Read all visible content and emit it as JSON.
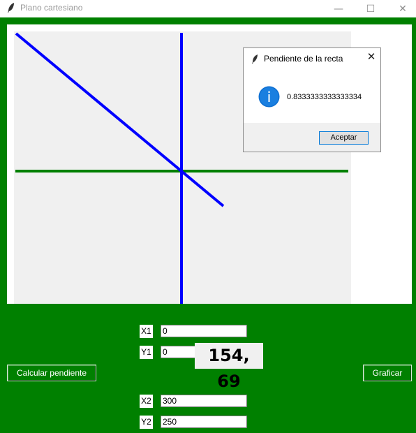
{
  "window": {
    "title": "Plano cartesiano",
    "controls": {
      "minimize": "—",
      "maximize": "☐",
      "close": "✕"
    }
  },
  "colors": {
    "frame": "#008000",
    "plot_background": "#f0f0f0",
    "axis_x": "#008000",
    "axis_y": "#0000ff",
    "line": "#0000ff"
  },
  "dialog": {
    "title": "Pendiente de la recta",
    "message": "0.8333333333333334",
    "ok_label": "Aceptar",
    "icon": "info-icon"
  },
  "form": {
    "x1": {
      "label": "X1",
      "value": "0"
    },
    "y1": {
      "label": "Y1",
      "value": "0"
    },
    "x2": {
      "label": "X2",
      "value": "300"
    },
    "y2": {
      "label": "Y2",
      "value": "250"
    }
  },
  "coords_display": "154, 69",
  "buttons": {
    "calcular": "Calcular pendiente",
    "graficar": "Graficar"
  }
}
